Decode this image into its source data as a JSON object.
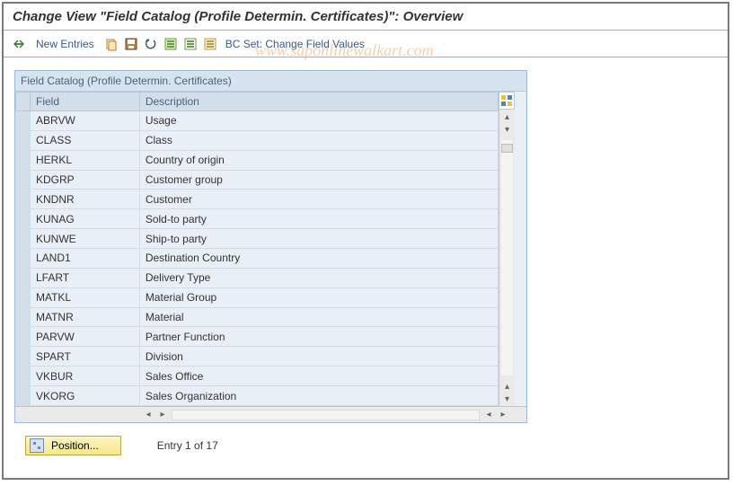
{
  "title": "Change View \"Field Catalog (Profile Determin. Certificates)\": Overview",
  "toolbar": {
    "new_entries": "New Entries",
    "bc_set": "BC Set: Change Field Values"
  },
  "panel_title": "Field Catalog (Profile Determin. Certificates)",
  "columns": {
    "field": "Field",
    "description": "Description"
  },
  "rows": [
    {
      "field": "ABRVW",
      "desc": "Usage"
    },
    {
      "field": "CLASS",
      "desc": "Class"
    },
    {
      "field": "HERKL",
      "desc": "Country of origin"
    },
    {
      "field": "KDGRP",
      "desc": "Customer group"
    },
    {
      "field": "KNDNR",
      "desc": "Customer"
    },
    {
      "field": "KUNAG",
      "desc": "Sold-to party"
    },
    {
      "field": "KUNWE",
      "desc": "Ship-to party"
    },
    {
      "field": "LAND1",
      "desc": "Destination Country"
    },
    {
      "field": "LFART",
      "desc": "Delivery Type"
    },
    {
      "field": "MATKL",
      "desc": "Material Group"
    },
    {
      "field": "MATNR",
      "desc": "Material"
    },
    {
      "field": "PARVW",
      "desc": "Partner Function"
    },
    {
      "field": "SPART",
      "desc": "Division"
    },
    {
      "field": "VKBUR",
      "desc": "Sales Office"
    },
    {
      "field": "VKORG",
      "desc": "Sales Organization"
    }
  ],
  "position_label": "Position...",
  "entry_text": "Entry 1 of 17",
  "watermark": "www.saponlinewalkart.com"
}
